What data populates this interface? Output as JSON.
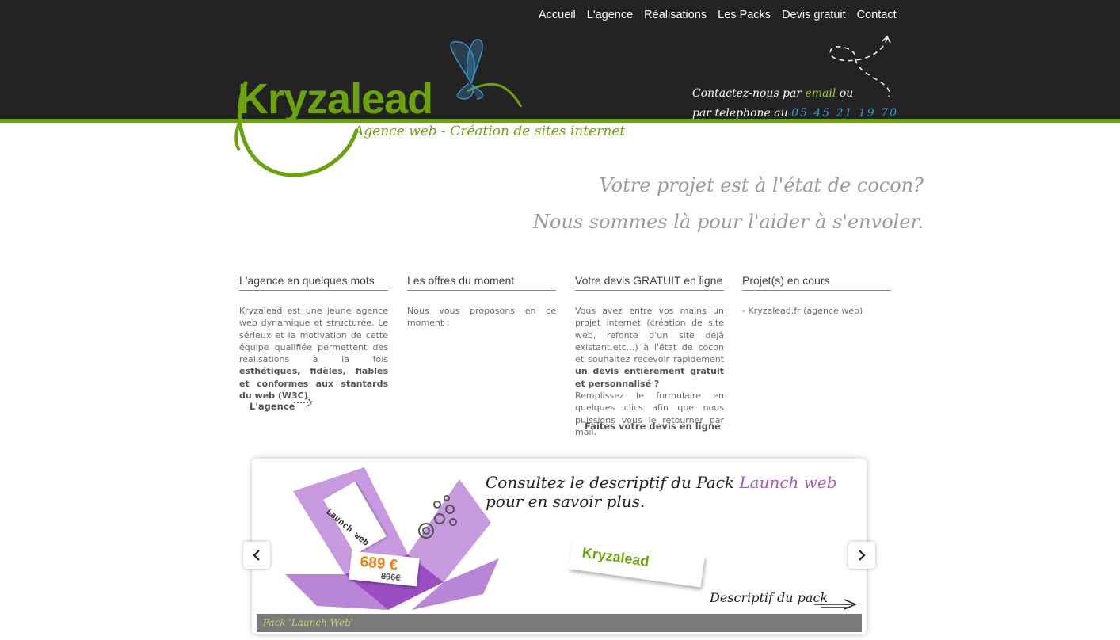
{
  "nav": {
    "items": [
      "Accueil",
      "L'agence",
      "Réalisations",
      "Les Packs",
      "Devis gratuit",
      "Contact"
    ]
  },
  "brand": {
    "name": "Kryzalead",
    "tagline": "Agence web - Création de sites internet"
  },
  "contact": {
    "line1_prefix": "Contactez-nous par",
    "email_label": "email",
    "line1_suffix": "ou",
    "line2_prefix": "par telephone au",
    "phone": "05 45 21 19 70"
  },
  "hero": {
    "line1": "Votre projet est à l'état de cocon?",
    "line2": "Nous sommes là pour l'aider à s'envoler."
  },
  "columns": {
    "agence": {
      "title": "L'agence en quelques mots",
      "text1": "Kryzalead est une jeune agence web dynamique et structurée. Le sérieux et la motivation de cette équipe qualifiée permettent des réalisations à la fois",
      "bold": "esthétiques, fidèles, fiables et conformes aux stantards du web (W3C)",
      "text2": ".",
      "link": "L'agence"
    },
    "offres": {
      "title": "Les offres du moment",
      "text": "Nous vous proposons en ce moment :"
    },
    "devis": {
      "title": "Votre devis GRATUIT en ligne",
      "text1": "Vous avez entre vos mains un projet internet (création de site web, refonte d'un site déjà existant,etc...) à l'état de cocon et souhaitez recevoir rapidement",
      "bold": "un devis entièrement gratuit et personnalisé ?",
      "text2": "Remplissez le formulaire en quelques clics afin que nous puissions vous le retourner par mail.",
      "link": "Faites votre devis en ligne"
    },
    "projets": {
      "title": "Projet(s) en cours",
      "text": "- Kryzalead.fr (agence web)"
    }
  },
  "slider": {
    "title_prefix": "Consultez le descriptif du Pack",
    "title_pack": "Launch web",
    "title_suffix": "pour en savoir plus.",
    "tag_text": "Launch web",
    "price": "689 €",
    "old_price": "896€",
    "mini_logo": "Kryzalead",
    "descriptif": "Descriptif du pack",
    "caption": "Pack 'Launch Web'"
  },
  "colors": {
    "header_bg": "#232323",
    "accent_green": "#6aa30c",
    "accent_blue": "#2f9ad8",
    "pack_purple": "#a55bc0",
    "price_orange": "#f07c12"
  }
}
